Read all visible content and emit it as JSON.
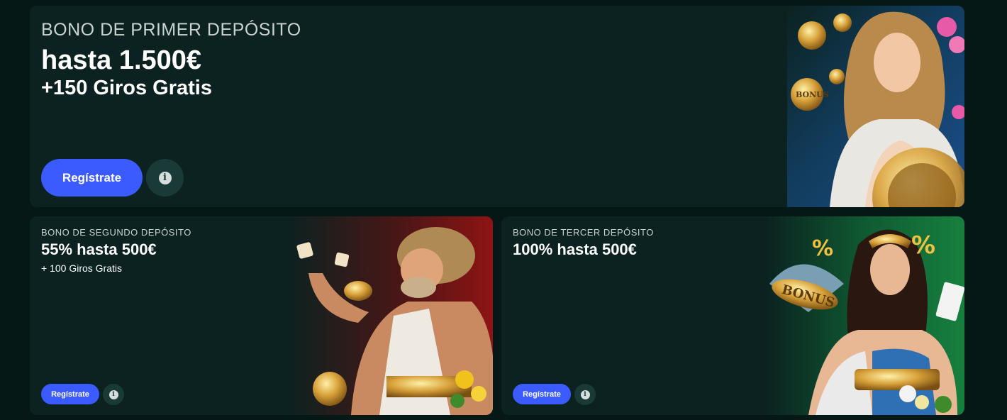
{
  "bonuses": [
    {
      "eyebrow": "BONO DE PRIMER DEPÓSITO",
      "headline": "hasta 1.500€",
      "subline": "+150 Giros Gratis",
      "register_label": "Regístrate",
      "info_icon": "info-icon",
      "art_text": "BONUS"
    },
    {
      "eyebrow": "BONO DE SEGUNDO DEPÓSITO",
      "headline": "55% hasta 500€",
      "subline": "+ 100 Giros Gratis",
      "register_label": "Regístrate",
      "info_icon": "info-icon"
    },
    {
      "eyebrow": "BONO DE TERCER DEPÓSITO",
      "headline": "100% hasta 500€",
      "register_label": "Regístrate",
      "info_icon": "info-icon",
      "art_text": "BONUS",
      "art_badge": "%"
    }
  ],
  "colors": {
    "background": "#051816",
    "card": "#0b2220",
    "accent": "#3b5bff",
    "info_bg": "#1a3a37"
  }
}
